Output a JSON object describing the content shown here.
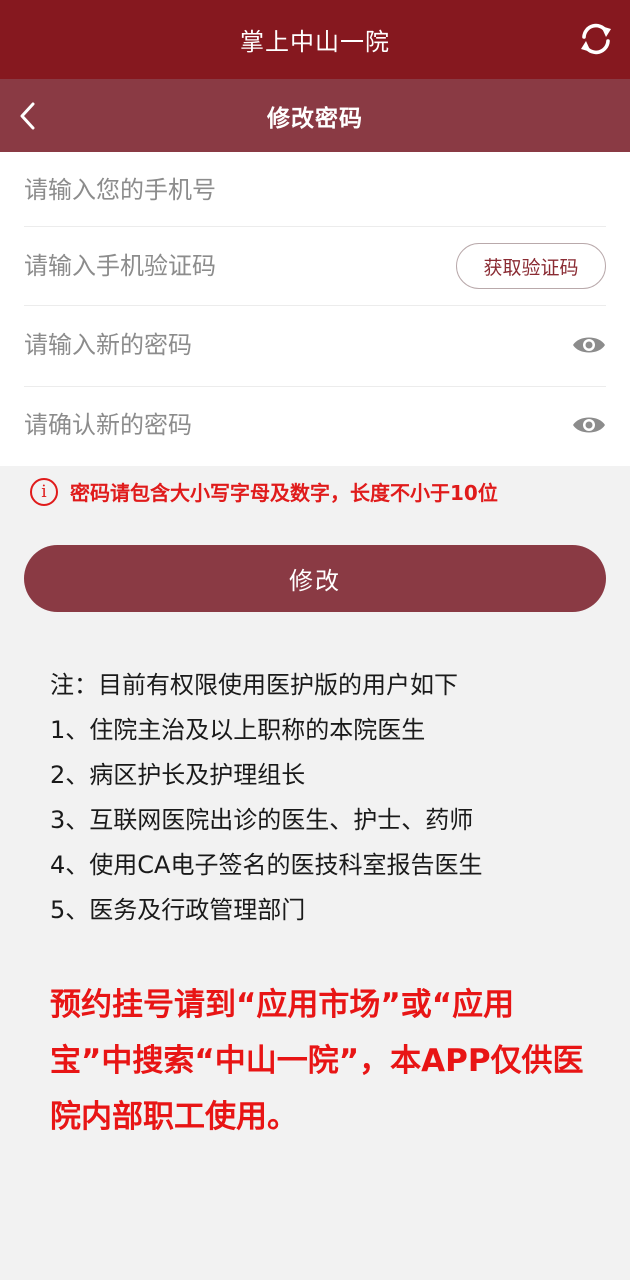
{
  "app": {
    "title": "掌上中山一院"
  },
  "nav": {
    "title": "修改密码"
  },
  "form": {
    "phone_placeholder": "请输入您的手机号",
    "code_placeholder": "请输入手机验证码",
    "get_code_label": "获取验证码",
    "new_password_placeholder": "请输入新的密码",
    "confirm_password_placeholder": "请确认新的密码"
  },
  "hint": {
    "icon": "info-icon",
    "text": "密码请包含大小写字母及数字，长度不小于10位"
  },
  "submit_label": "修改",
  "notes": {
    "heading": "注：目前有权限使用医护版的用户如下",
    "items": [
      "1、住院主治及以上职称的本院医生",
      "2、病区护长及护理组长",
      "3、互联网医院出诊的医生、护士、药师",
      "4、使用CA电子签名的医技科室报告医生",
      "5、医务及行政管理部门"
    ]
  },
  "warning": "预约挂号请到“应用市场”或“应用宝”中搜索“中山一院”，本APP仅供医院内部职工使用。",
  "icons": {
    "refresh": "refresh-icon",
    "back": "chevron-left-icon",
    "eye": "eye-icon"
  },
  "colors": {
    "topbar": "#86181f",
    "navbar": "#8a3a44",
    "button": "#8a3a44",
    "warning": "#e81515",
    "background": "#f2f2f2"
  }
}
